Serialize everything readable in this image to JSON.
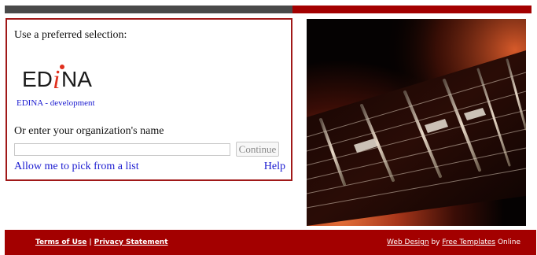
{
  "login": {
    "prompt": "Use a preferred selection:",
    "logo_text": "EDiNA",
    "logo_alt": "EDINA - development",
    "or_label": "Or enter your organization's name",
    "org_input_value": "",
    "org_input_placeholder": "",
    "continue_label": "Continue",
    "pick_list_label": "Allow me to pick from a list",
    "help_label": "Help"
  },
  "footer": {
    "terms_label": "Terms of Use",
    "separator": "|",
    "privacy_label": "Privacy Statement",
    "web_design_label": "Web Design",
    "by_text": " by ",
    "free_templates_label": "Free Templates",
    "online_text": " Online"
  },
  "colors": {
    "accent_red": "#a30000",
    "topbar_dark": "#4a4a4a",
    "link_blue": "#1a1ad0",
    "logo_i_red": "#e0301e"
  },
  "icons": {
    "photo": "guitar-neck-photo"
  }
}
